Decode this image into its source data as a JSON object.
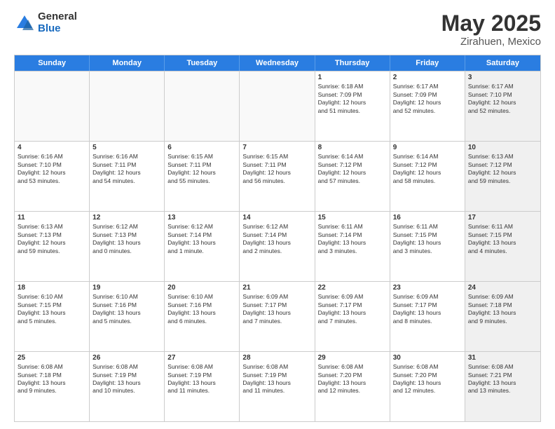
{
  "header": {
    "logo_general": "General",
    "logo_blue": "Blue",
    "title": "May 2025",
    "location": "Zirahuen, Mexico"
  },
  "calendar": {
    "days_of_week": [
      "Sunday",
      "Monday",
      "Tuesday",
      "Wednesday",
      "Thursday",
      "Friday",
      "Saturday"
    ],
    "rows": [
      [
        {
          "day": "",
          "info": "",
          "empty": true
        },
        {
          "day": "",
          "info": "",
          "empty": true
        },
        {
          "day": "",
          "info": "",
          "empty": true
        },
        {
          "day": "",
          "info": "",
          "empty": true
        },
        {
          "day": "1",
          "info": "Sunrise: 6:18 AM\nSunset: 7:09 PM\nDaylight: 12 hours\nand 51 minutes.",
          "empty": false
        },
        {
          "day": "2",
          "info": "Sunrise: 6:17 AM\nSunset: 7:09 PM\nDaylight: 12 hours\nand 52 minutes.",
          "empty": false
        },
        {
          "day": "3",
          "info": "Sunrise: 6:17 AM\nSunset: 7:10 PM\nDaylight: 12 hours\nand 52 minutes.",
          "empty": false,
          "shaded": true
        }
      ],
      [
        {
          "day": "4",
          "info": "Sunrise: 6:16 AM\nSunset: 7:10 PM\nDaylight: 12 hours\nand 53 minutes.",
          "empty": false
        },
        {
          "day": "5",
          "info": "Sunrise: 6:16 AM\nSunset: 7:11 PM\nDaylight: 12 hours\nand 54 minutes.",
          "empty": false
        },
        {
          "day": "6",
          "info": "Sunrise: 6:15 AM\nSunset: 7:11 PM\nDaylight: 12 hours\nand 55 minutes.",
          "empty": false
        },
        {
          "day": "7",
          "info": "Sunrise: 6:15 AM\nSunset: 7:11 PM\nDaylight: 12 hours\nand 56 minutes.",
          "empty": false
        },
        {
          "day": "8",
          "info": "Sunrise: 6:14 AM\nSunset: 7:12 PM\nDaylight: 12 hours\nand 57 minutes.",
          "empty": false
        },
        {
          "day": "9",
          "info": "Sunrise: 6:14 AM\nSunset: 7:12 PM\nDaylight: 12 hours\nand 58 minutes.",
          "empty": false
        },
        {
          "day": "10",
          "info": "Sunrise: 6:13 AM\nSunset: 7:12 PM\nDaylight: 12 hours\nand 59 minutes.",
          "empty": false,
          "shaded": true
        }
      ],
      [
        {
          "day": "11",
          "info": "Sunrise: 6:13 AM\nSunset: 7:13 PM\nDaylight: 12 hours\nand 59 minutes.",
          "empty": false
        },
        {
          "day": "12",
          "info": "Sunrise: 6:12 AM\nSunset: 7:13 PM\nDaylight: 13 hours\nand 0 minutes.",
          "empty": false
        },
        {
          "day": "13",
          "info": "Sunrise: 6:12 AM\nSunset: 7:14 PM\nDaylight: 13 hours\nand 1 minute.",
          "empty": false
        },
        {
          "day": "14",
          "info": "Sunrise: 6:12 AM\nSunset: 7:14 PM\nDaylight: 13 hours\nand 2 minutes.",
          "empty": false
        },
        {
          "day": "15",
          "info": "Sunrise: 6:11 AM\nSunset: 7:14 PM\nDaylight: 13 hours\nand 3 minutes.",
          "empty": false
        },
        {
          "day": "16",
          "info": "Sunrise: 6:11 AM\nSunset: 7:15 PM\nDaylight: 13 hours\nand 3 minutes.",
          "empty": false
        },
        {
          "day": "17",
          "info": "Sunrise: 6:11 AM\nSunset: 7:15 PM\nDaylight: 13 hours\nand 4 minutes.",
          "empty": false,
          "shaded": true
        }
      ],
      [
        {
          "day": "18",
          "info": "Sunrise: 6:10 AM\nSunset: 7:15 PM\nDaylight: 13 hours\nand 5 minutes.",
          "empty": false
        },
        {
          "day": "19",
          "info": "Sunrise: 6:10 AM\nSunset: 7:16 PM\nDaylight: 13 hours\nand 5 minutes.",
          "empty": false
        },
        {
          "day": "20",
          "info": "Sunrise: 6:10 AM\nSunset: 7:16 PM\nDaylight: 13 hours\nand 6 minutes.",
          "empty": false
        },
        {
          "day": "21",
          "info": "Sunrise: 6:09 AM\nSunset: 7:17 PM\nDaylight: 13 hours\nand 7 minutes.",
          "empty": false
        },
        {
          "day": "22",
          "info": "Sunrise: 6:09 AM\nSunset: 7:17 PM\nDaylight: 13 hours\nand 7 minutes.",
          "empty": false
        },
        {
          "day": "23",
          "info": "Sunrise: 6:09 AM\nSunset: 7:17 PM\nDaylight: 13 hours\nand 8 minutes.",
          "empty": false
        },
        {
          "day": "24",
          "info": "Sunrise: 6:09 AM\nSunset: 7:18 PM\nDaylight: 13 hours\nand 9 minutes.",
          "empty": false,
          "shaded": true
        }
      ],
      [
        {
          "day": "25",
          "info": "Sunrise: 6:08 AM\nSunset: 7:18 PM\nDaylight: 13 hours\nand 9 minutes.",
          "empty": false
        },
        {
          "day": "26",
          "info": "Sunrise: 6:08 AM\nSunset: 7:19 PM\nDaylight: 13 hours\nand 10 minutes.",
          "empty": false
        },
        {
          "day": "27",
          "info": "Sunrise: 6:08 AM\nSunset: 7:19 PM\nDaylight: 13 hours\nand 11 minutes.",
          "empty": false
        },
        {
          "day": "28",
          "info": "Sunrise: 6:08 AM\nSunset: 7:19 PM\nDaylight: 13 hours\nand 11 minutes.",
          "empty": false
        },
        {
          "day": "29",
          "info": "Sunrise: 6:08 AM\nSunset: 7:20 PM\nDaylight: 13 hours\nand 12 minutes.",
          "empty": false
        },
        {
          "day": "30",
          "info": "Sunrise: 6:08 AM\nSunset: 7:20 PM\nDaylight: 13 hours\nand 12 minutes.",
          "empty": false
        },
        {
          "day": "31",
          "info": "Sunrise: 6:08 AM\nSunset: 7:21 PM\nDaylight: 13 hours\nand 13 minutes.",
          "empty": false,
          "shaded": true
        }
      ]
    ]
  }
}
